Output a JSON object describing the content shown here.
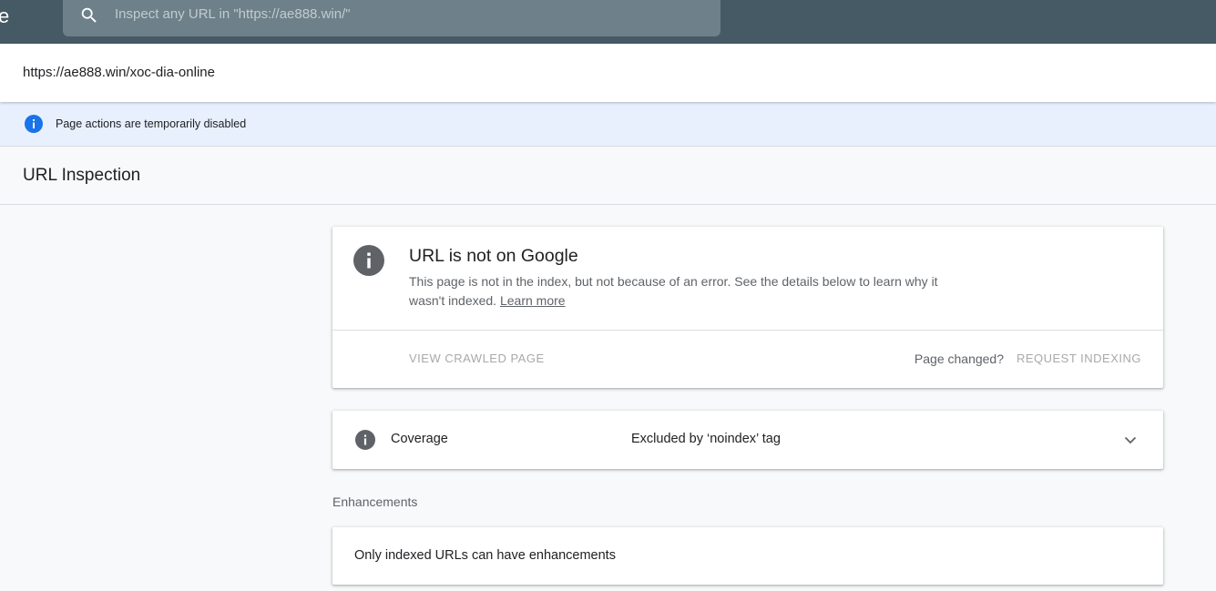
{
  "topbar": {
    "edge_char": "e",
    "search": {
      "placeholder": "Inspect any URL in \"https://ae888.win/\"",
      "icon": "search-icon"
    }
  },
  "url_row": {
    "url": "https://ae888.win/xoc-dia-online"
  },
  "banner": {
    "icon": "info-icon",
    "text": "Page actions are temporarily disabled",
    "color": "#1a73e8"
  },
  "page": {
    "title": "URL Inspection"
  },
  "status_card": {
    "icon": "info-icon",
    "title": "URL is not on Google",
    "description": "This page is not in the index, but not because of an error. See the details below to learn why it wasn't indexed.",
    "learn_more": "Learn more",
    "view_crawled": "VIEW CRAWLED PAGE",
    "page_changed": "Page changed?",
    "request_indexing": "REQUEST INDEXING"
  },
  "coverage": {
    "icon": "info-icon",
    "label": "Coverage",
    "value": "Excluded by ‘noindex’ tag",
    "expand_icon": "chevron-down-icon"
  },
  "enhancements": {
    "heading": "Enhancements",
    "text": "Only indexed URLs can have enhancements"
  },
  "colors": {
    "topbar": "#455a64",
    "accent_blue": "#1a73e8",
    "icon_gray": "#5f6368"
  }
}
